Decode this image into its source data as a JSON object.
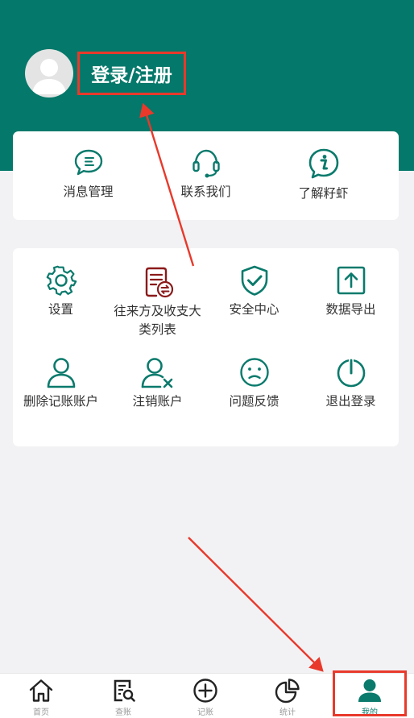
{
  "header": {
    "login_label": "登录/注册",
    "bg_color": "#04786a"
  },
  "quick_links": [
    {
      "icon": "message-bubble-icon",
      "label": "消息管理"
    },
    {
      "icon": "headset-icon",
      "label": "联系我们"
    },
    {
      "icon": "info-icon",
      "label": "了解籽虾"
    }
  ],
  "grid_menu": [
    {
      "icon": "gear-icon",
      "label": "设置"
    },
    {
      "icon": "document-transfer-icon",
      "label": "往来方及收支大类列表"
    },
    {
      "icon": "shield-check-icon",
      "label": "安全中心"
    },
    {
      "icon": "export-icon",
      "label": "数据导出"
    },
    {
      "icon": "user-icon",
      "label": "删除记账账户"
    },
    {
      "icon": "user-remove-icon",
      "label": "注销账户"
    },
    {
      "icon": "sad-face-icon",
      "label": "问题反馈"
    },
    {
      "icon": "power-icon",
      "label": "退出登录"
    }
  ],
  "tabbar": {
    "items": [
      {
        "icon": "home-icon",
        "label": "首页"
      },
      {
        "icon": "search-ledger-icon",
        "label": "查账"
      },
      {
        "icon": "plus-circle-icon",
        "label": "记账"
      },
      {
        "icon": "pie-chart-icon",
        "label": "统计"
      },
      {
        "icon": "person-icon",
        "label": "我的"
      }
    ],
    "active_index": 4
  },
  "colors": {
    "accent": "#0a7a6c",
    "annotation": "#e8392b",
    "transfer_icon": "#8b1a1a"
  }
}
